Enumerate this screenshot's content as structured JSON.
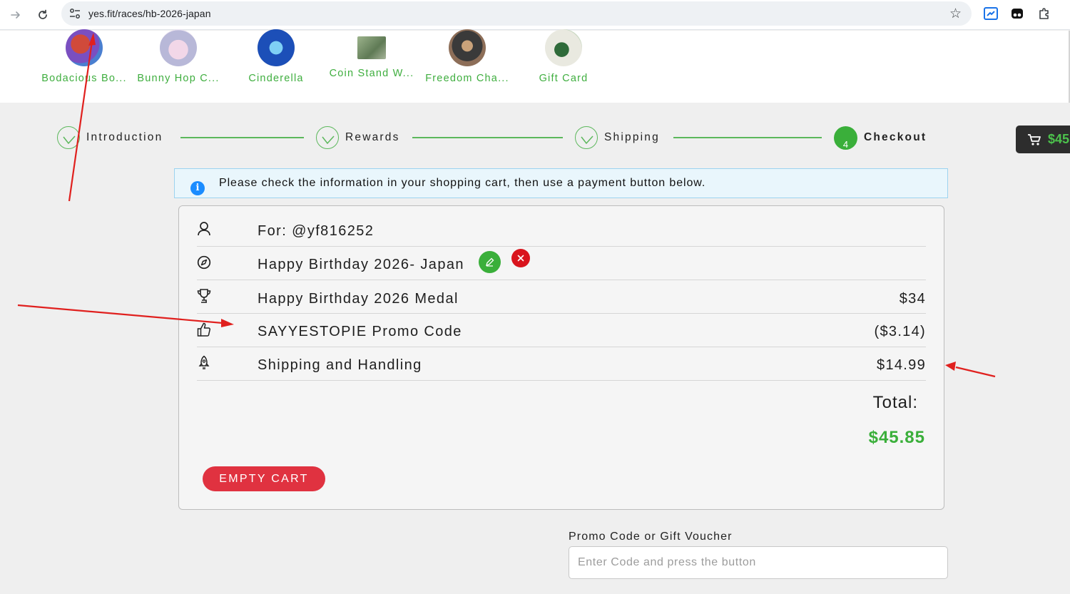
{
  "browser": {
    "url": "yes.fit/races/hb-2026-japan"
  },
  "races": [
    {
      "name": "Bodacious Bo..."
    },
    {
      "name": "Bunny Hop C..."
    },
    {
      "name": "Cinderella"
    },
    {
      "name": "Coin Stand W..."
    },
    {
      "name": "Freedom Cha..."
    },
    {
      "name": "Gift Card"
    }
  ],
  "stepper": {
    "steps": [
      {
        "label": "Introduction",
        "state": "done"
      },
      {
        "label": "Rewards",
        "state": "done"
      },
      {
        "label": "Shipping",
        "state": "done"
      },
      {
        "label": "Checkout",
        "state": "active",
        "number": "4"
      }
    ]
  },
  "cart_chip": {
    "amount": "$45"
  },
  "info": {
    "text": "Please check the information in your shopping cart, then use a payment button below."
  },
  "cart": {
    "rows": [
      {
        "icon": "user-icon",
        "label": "For: @yf816252",
        "amount": ""
      },
      {
        "icon": "compass-icon",
        "label": "Happy Birthday 2026- Japan",
        "amount": ""
      },
      {
        "icon": "trophy-icon",
        "label": "Happy Birthday 2026 Medal",
        "amount": "$34"
      },
      {
        "icon": "thumbs-up-icon",
        "label": "SAYYESTOPIE Promo Code",
        "amount": "($3.14)"
      },
      {
        "icon": "shipping-icon",
        "label": "Shipping and Handling",
        "amount": "$14.99"
      }
    ],
    "total_label": "Total:",
    "total_amount": "$45.85",
    "empty_cart_label": "EMPTY CART"
  },
  "promo": {
    "label": "Promo Code or Gift Voucher",
    "placeholder": "Enter Code and press the button"
  },
  "colors": {
    "accent_green": "#3aaf3a",
    "danger_red": "#e03240",
    "annotation_red": "#e0201e",
    "info_blue": "#1a8cff"
  }
}
